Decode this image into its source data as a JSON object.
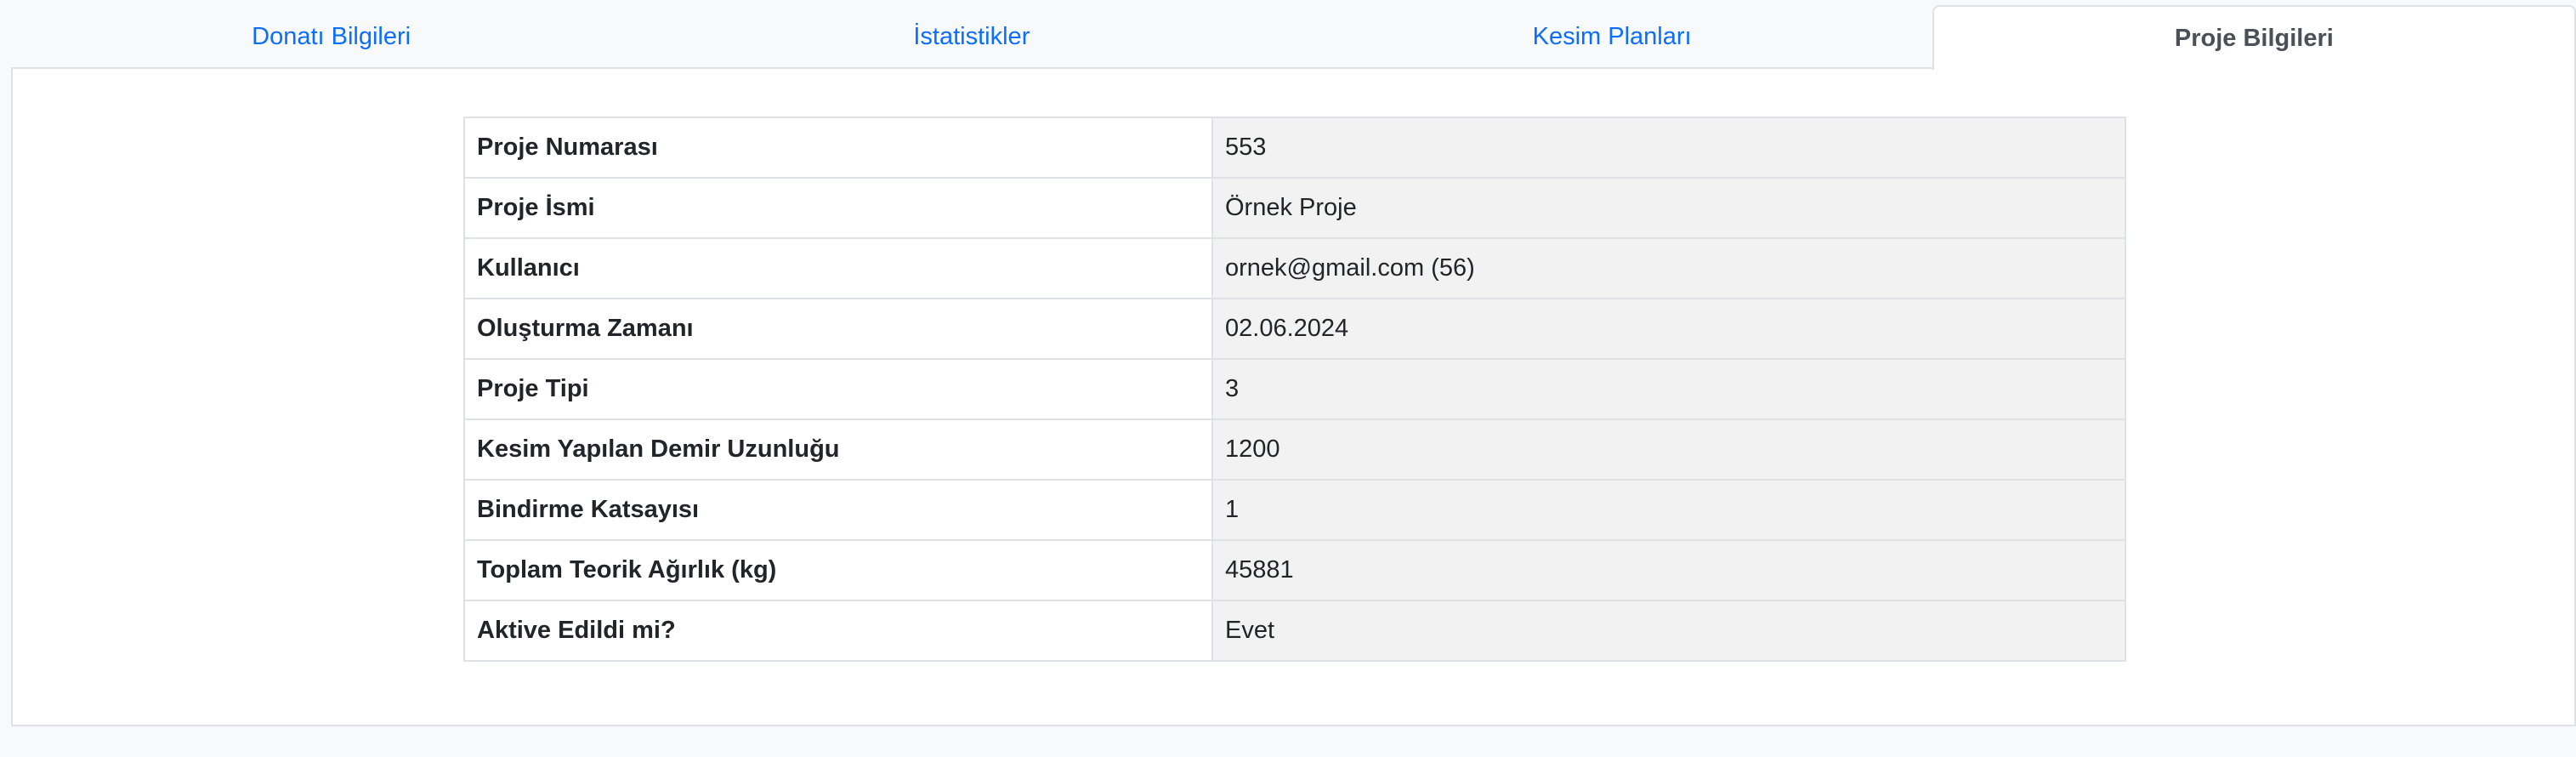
{
  "tabs": [
    {
      "label": "Donatı Bilgileri",
      "active": false
    },
    {
      "label": "İstatistikler",
      "active": false
    },
    {
      "label": "Kesim Planları",
      "active": false
    },
    {
      "label": "Proje Bilgileri",
      "active": true
    }
  ],
  "project_info": {
    "rows": [
      {
        "label": "Proje Numarası",
        "value": "553"
      },
      {
        "label": "Proje İsmi",
        "value": "Örnek Proje"
      },
      {
        "label": "Kullanıcı",
        "value": "ornek@gmail.com (56)"
      },
      {
        "label": "Oluşturma Zamanı",
        "value": "02.06.2024"
      },
      {
        "label": "Proje Tipi",
        "value": "3"
      },
      {
        "label": "Kesim Yapılan Demir Uzunluğu",
        "value": "1200"
      },
      {
        "label": "Bindirme Katsayısı",
        "value": "1"
      },
      {
        "label": "Toplam Teorik Ağırlık (kg)",
        "value": "45881"
      },
      {
        "label": "Aktive Edildi mi?",
        "value": "Evet"
      }
    ]
  },
  "colors": {
    "link": "#0d6efd",
    "active_tab_text": "#495057",
    "value_cell_bg": "#f2f2f2",
    "border": "#dee2e6",
    "page_bg": "#f8f9fa"
  }
}
